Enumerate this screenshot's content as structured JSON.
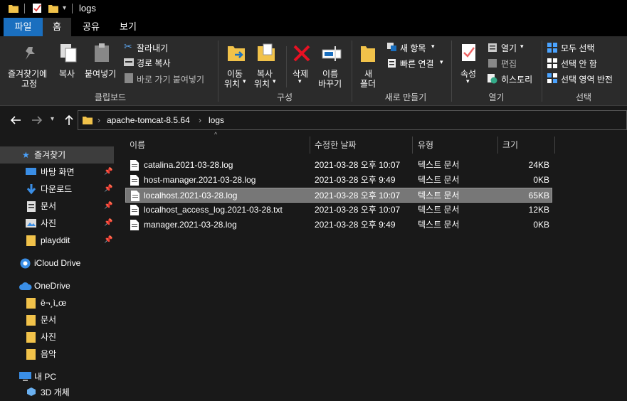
{
  "window": {
    "title": "logs",
    "qat_dropdown": "▾"
  },
  "tabs": {
    "file": "파일",
    "home": "홈",
    "share": "공유",
    "view": "보기"
  },
  "ribbon": {
    "clipboard": {
      "pin_line1": "즐겨찾기에",
      "pin_line2": "고정",
      "copy": "복사",
      "paste": "붙여넣기",
      "cut": "잘라내기",
      "copy_path": "경로 복사",
      "paste_shortcut": "바로 가기 붙여넣기",
      "group": "클립보드"
    },
    "organize": {
      "move1": "이동",
      "move2": "위치",
      "copy1": "복사",
      "copy2": "위치",
      "delete": "삭제",
      "rename1": "이름",
      "rename2": "바꾸기",
      "group": "구성"
    },
    "new": {
      "folder1": "새",
      "folder2": "폴더",
      "new_item": "새 항목",
      "easy_access": "빠른 연결",
      "group": "새로 만들기"
    },
    "open": {
      "properties": "속성",
      "open": "열기",
      "edit": "편집",
      "history": "히스토리",
      "group": "열기"
    },
    "select": {
      "select_all": "모두 선택",
      "select_none": "선택 안 함",
      "invert": "선택 영역 반전",
      "group": "선택"
    }
  },
  "addressbar": {
    "crumbs": [
      "apache-tomcat-8.5.64",
      "logs"
    ],
    "sep": "›"
  },
  "navigation": {
    "quick_access": "즐겨찾기",
    "quick_items": [
      {
        "label": "바탕 화면"
      },
      {
        "label": "다운로드"
      },
      {
        "label": "문서"
      },
      {
        "label": "사진"
      },
      {
        "label": "playddit"
      }
    ],
    "icloud": "iCloud Drive",
    "onedrive": "OneDrive",
    "onedrive_items": [
      {
        "label": "ë¬¸ì„œ"
      },
      {
        "label": "문서"
      },
      {
        "label": "사진"
      },
      {
        "label": "음악"
      }
    ],
    "this_pc": "내 PC",
    "objects3d": "3D 개체"
  },
  "columns": {
    "name": "이름",
    "modified": "수정한 날짜",
    "type": "유형",
    "size": "크기"
  },
  "files": [
    {
      "name": "catalina.2021-03-28.log",
      "modified": "2021-03-28 오후 10:07",
      "type": "텍스트 문서",
      "size": "24KB"
    },
    {
      "name": "host-manager.2021-03-28.log",
      "modified": "2021-03-28 오후 9:49",
      "type": "텍스트 문서",
      "size": "0KB"
    },
    {
      "name": "localhost.2021-03-28.log",
      "modified": "2021-03-28 오후 10:07",
      "type": "텍스트 문서",
      "size": "65KB"
    },
    {
      "name": "localhost_access_log.2021-03-28.txt",
      "modified": "2021-03-28 오후 10:07",
      "type": "텍스트 문서",
      "size": "12KB"
    },
    {
      "name": "manager.2021-03-28.log",
      "modified": "2021-03-28 오후 9:49",
      "type": "텍스트 문서",
      "size": "0KB"
    }
  ],
  "colors": {
    "accent": "#1a6fbf",
    "folder": "#f1c24a",
    "selected_row": "#777777"
  }
}
